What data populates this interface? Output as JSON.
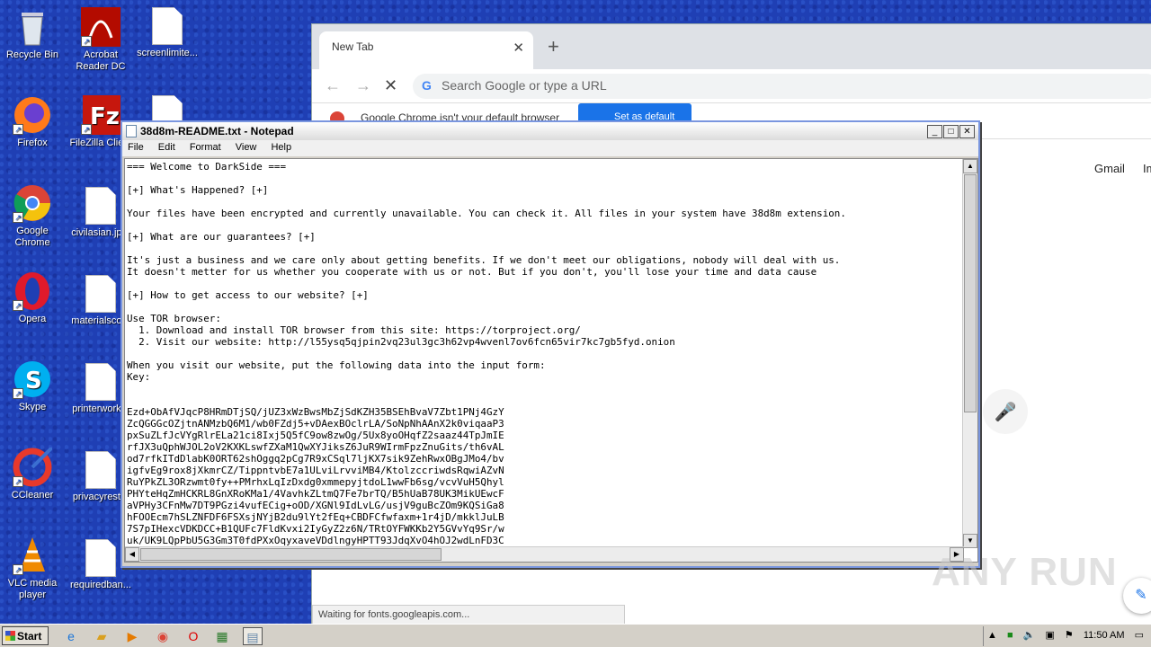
{
  "desktop": {
    "icons": [
      {
        "label": "Recycle Bin"
      },
      {
        "label": "Acrobat Reader DC"
      },
      {
        "label": "screenlimite..."
      },
      {
        "label": "Firefox"
      },
      {
        "label": "FileZilla Clie..."
      },
      {
        "label": "Google Chrome"
      },
      {
        "label": "civilasian.jp..."
      },
      {
        "label": "Opera"
      },
      {
        "label": "materialsco..."
      },
      {
        "label": "Skype"
      },
      {
        "label": "printerwork..."
      },
      {
        "label": "CCleaner"
      },
      {
        "label": "privacyrest..."
      },
      {
        "label": "VLC media player"
      },
      {
        "label": "requiredban..."
      }
    ]
  },
  "chrome": {
    "tab_title": "New Tab",
    "omnibox_placeholder": "Search Google or type a URL",
    "infobar_text": "Google Chrome isn't your default browser",
    "infobar_button": "Set as default",
    "links": [
      "Gmail",
      "Ima"
    ],
    "status": "Waiting for fonts.googleapis.com..."
  },
  "notepad": {
    "title": "38d8m-README.txt - Notepad",
    "menu": [
      "File",
      "Edit",
      "Format",
      "View",
      "Help"
    ],
    "content": "=== Welcome to DarkSide ===\n\n[+] What's Happened? [+]\n\nYour files have been encrypted and currently unavailable. You can check it. All files in your system have 38d8m extension.\n\n[+] What are our guarantees? [+]\n\nIt's just a business and we care only about getting benefits. If we don't meet our obligations, nobody will deal with us.\nIt doesn't metter for us whether you cooperate with us or not. But if you don't, you'll lose your time and data cause\n\n[+] How to get access to our website? [+]\n\nUse TOR browser:\n  1. Download and install TOR browser from this site: https://torproject.org/\n  2. Visit our website: http://l55ysq5qjpin2vq23ul3gc3h62vp4wvenl7ov6fcn65vir7kc7gb5fyd.onion\n\nWhen you visit our website, put the following data into the input form:\nKey:\n\n\nEzd+ObAfVJqcP8HRmDTjSQ/jUZ3xWzBwsMbZjSdKZH35BSEhBvaV7Zbt1PNj4GzY\nZcQGGGcOZjtnANMzbQ6M1/wb0FZdj5+vDAexBOclrLA/SoNpNhAAnX2k0viqaaP3\npxSuZLfJcVYgRlrELa21ci8Ixj5Q5fC9ow8zwOg/5Ux8yoOHqfZ2saaz44TpJmIE\nrfJX3uQphWJOL2oV2KXKLswfZXaM1QwXYJiksZ6JuR9WIrmFpzZnuGits/th6vAL\nod7rfkITdDlabK0ORT62shOggq2pCg7R9xCSql7ljKX7sik9ZehRwxOBgJMo4/bv\nigfvEg9rox8jXkmrCZ/TippntvbE7a1ULviLrvviMB4/KtolzccriwdsRqwiAZvN\nRuYPkZL3ORzwmt0fy++PMrhxLqIzDxdg0xmmepyjtdoL1wwFb6sg/vcvVuH5Qhyl\nPHYteHqZmHCKRL8GnXRoKMa1/4VavhkZLtmQ7Fe7brTQ/B5hUaB78UK3MikUEwcF\naVPHy3CFnMw7DT9PGzi4vufECig+oOD/XGNl9IdLvLG/usjV9guBcZOm9KQSiGa8\nhFOOEcm7hSLZNFDF6FSXsjNYjB2du9lYt2fEq+CBDFCfwfaxm+1r4jD/mkklJuLB\n7S7pIHexcVDKDCC+B1QUFc7FldKvxi2IyGyZ2z6N/TRtOYFWKKb2Y5GVvYq9Sr/w\nuk/UK9LQpPbU5G3Gm3T0fdPXxOqyxaveVDdlngyHPTT93JdqXvO4hOJ2wdLnFD3C"
  },
  "watermark": "ANY RUN",
  "taskbar": {
    "start": "Start",
    "clock": "11:50 AM"
  }
}
